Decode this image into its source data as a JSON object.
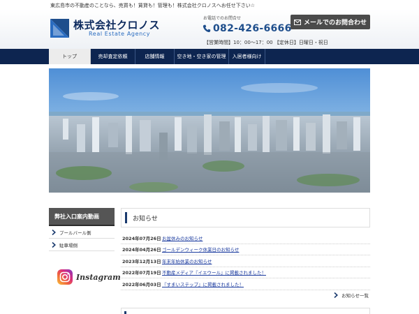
{
  "header": {
    "tagline": "東広島市の不動産のことなら、売買も！賃貸も！管理も！株式会社クロノスへお任せ下さい☆",
    "logo_jp": "株式会社クロノス",
    "logo_en": "Real Estate Agency",
    "tel_note": "お電話でのお問合せ",
    "tel_number": "082-426-6666",
    "contact_button": "メールでのお問合わせ",
    "hours": "【営業時間】10：00～17：00 【定休日】日曜日・祝日"
  },
  "nav": {
    "items": [
      {
        "label": "トップ",
        "active": true
      },
      {
        "label": "売却査定依頼",
        "active": false
      },
      {
        "label": "店舗情報",
        "active": false
      },
      {
        "label": "空き地・空き家の管理",
        "active": false
      },
      {
        "label": "入居者様向け",
        "active": false
      }
    ]
  },
  "sidebar": {
    "heading": "弊社入口案内動画",
    "items": [
      {
        "label": "プールバール側"
      },
      {
        "label": "駐車場側"
      }
    ],
    "instagram_label": "Instagram"
  },
  "news": {
    "title": "お知らせ",
    "items": [
      {
        "date": "2024年07月26日",
        "text": "お盆休みのお知らせ"
      },
      {
        "date": "2024年04月26日",
        "text": "ゴールデンウィーク休業日のお知らせ"
      },
      {
        "date": "2023年12月13日",
        "text": "年末年始休業のお知らせ"
      },
      {
        "date": "2022年07月19日",
        "text": "不動産メディア『イエウール』に掲載されました！"
      },
      {
        "date": "2022年06月03日",
        "text": "『すまいステップ』に掲載されました！"
      }
    ],
    "more_label": "お知らせ一覧"
  },
  "colors": {
    "navy": "#0d2550",
    "accent_blue": "#1e4e8c",
    "button_gray": "#4b4b4b"
  }
}
